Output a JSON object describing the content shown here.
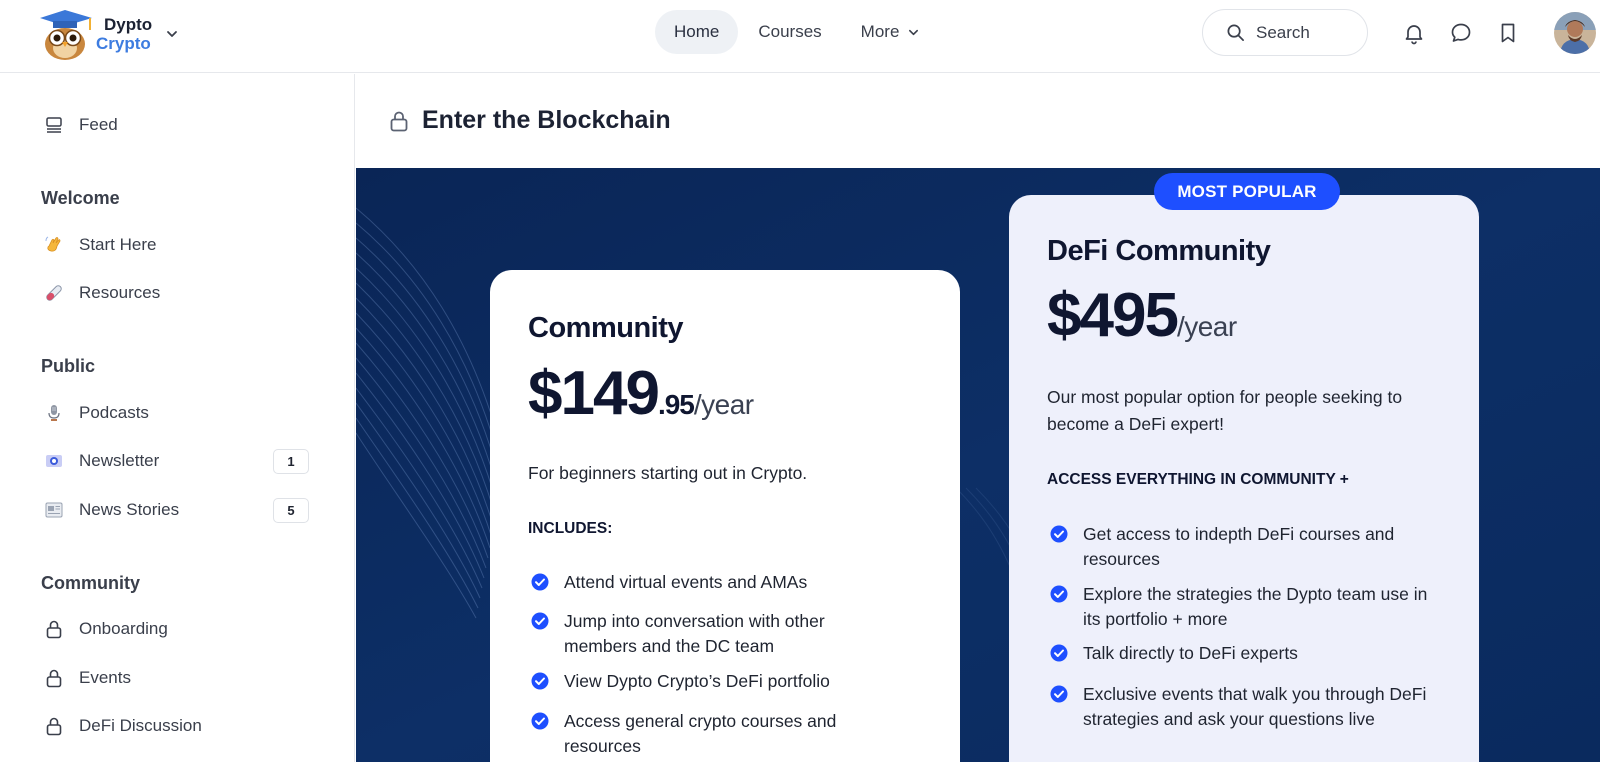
{
  "brand": {
    "line1": "Dypto",
    "line2": "Crypto"
  },
  "nav": {
    "items": [
      {
        "label": "Home",
        "active": true
      },
      {
        "label": "Courses",
        "active": false
      },
      {
        "label": "More",
        "active": false
      }
    ]
  },
  "search": {
    "placeholder": "Search"
  },
  "header_icons": [
    "bell-icon",
    "chat-icon",
    "bookmark-icon"
  ],
  "sidebar": {
    "feed": {
      "label": "Feed",
      "icon": "feed-icon"
    },
    "sections": [
      {
        "heading": "Welcome",
        "items": [
          {
            "label": "Start Here",
            "icon": "wave-hand-icon"
          },
          {
            "label": "Resources",
            "icon": "test-tube-icon"
          }
        ]
      },
      {
        "heading": "Public",
        "items": [
          {
            "label": "Podcasts",
            "icon": "microphone-icon"
          },
          {
            "label": "Newsletter",
            "icon": "newsletter-icon",
            "badge": "1"
          },
          {
            "label": "News Stories",
            "icon": "newspaper-icon",
            "badge": "5"
          }
        ]
      },
      {
        "heading": "Community",
        "items": [
          {
            "label": "Onboarding",
            "icon": "lock-icon"
          },
          {
            "label": "Events",
            "icon": "lock-icon"
          },
          {
            "label": "DeFi Discussion",
            "icon": "lock-icon"
          }
        ]
      }
    ]
  },
  "main": {
    "title": "Enter the Blockchain",
    "plans": [
      {
        "name": "Community",
        "price_main": "$149",
        "price_cents": ".95",
        "price_period": "/year",
        "description": "For beginners starting out in Crypto.",
        "includes_heading": "INCLUDES:",
        "features": [
          "Attend virtual events and AMAs",
          "Jump into conversation with other members and the DC team",
          "View Dypto Crypto’s DeFi portfolio",
          "Access general crypto courses and resources"
        ]
      },
      {
        "badge": "MOST POPULAR",
        "name": "DeFi Community",
        "price_main": "$495",
        "price_period": "/year",
        "description": "Our most popular option for people seeking to become a DeFi expert!",
        "includes_heading": "ACCESS EVERYTHING IN COMMUNITY +",
        "features": [
          "Get access to indepth DeFi courses and resources",
          "Explore the strategies the Dypto team use in its portfolio + more",
          "Talk directly to DeFi experts",
          "Exclusive events that walk you through DeFi strategies and ask your questions live"
        ]
      }
    ]
  },
  "colors": {
    "accent_blue": "#1e4fff",
    "hero_bg": "#0b2a5c",
    "brand_blue": "#3d7ce0",
    "check_blue": "#1e4fff"
  }
}
